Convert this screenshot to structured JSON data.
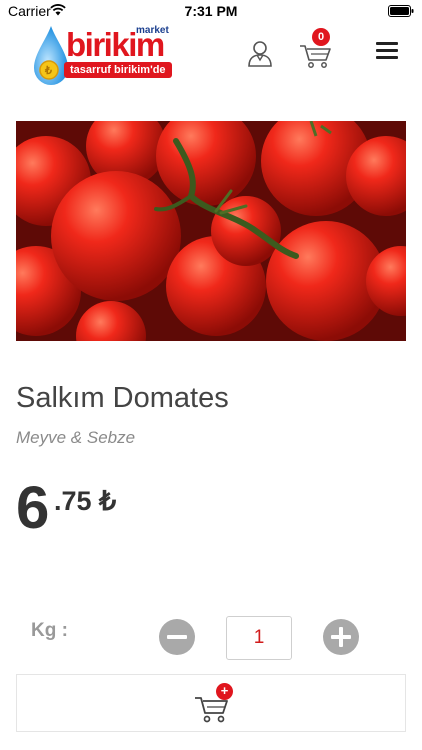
{
  "status_bar": {
    "carrier": "Carrier",
    "time": "7:31 PM"
  },
  "header": {
    "logo_word": "birikim",
    "logo_market": "market",
    "logo_tagline": "tasarruf birikim'de",
    "cart_count": "0"
  },
  "product": {
    "name": "Salkım Domates",
    "category": "Meyve & Sebze",
    "price_integer": "6",
    "price_decimal": ".75 ₺",
    "unit_label": "Kg :",
    "quantity": "1"
  },
  "add_to_cart_badge": "+",
  "colors": {
    "brand_red": "#e0161e",
    "brand_blue": "#1b3f8f",
    "stepper_gray": "#a9a9a9"
  }
}
